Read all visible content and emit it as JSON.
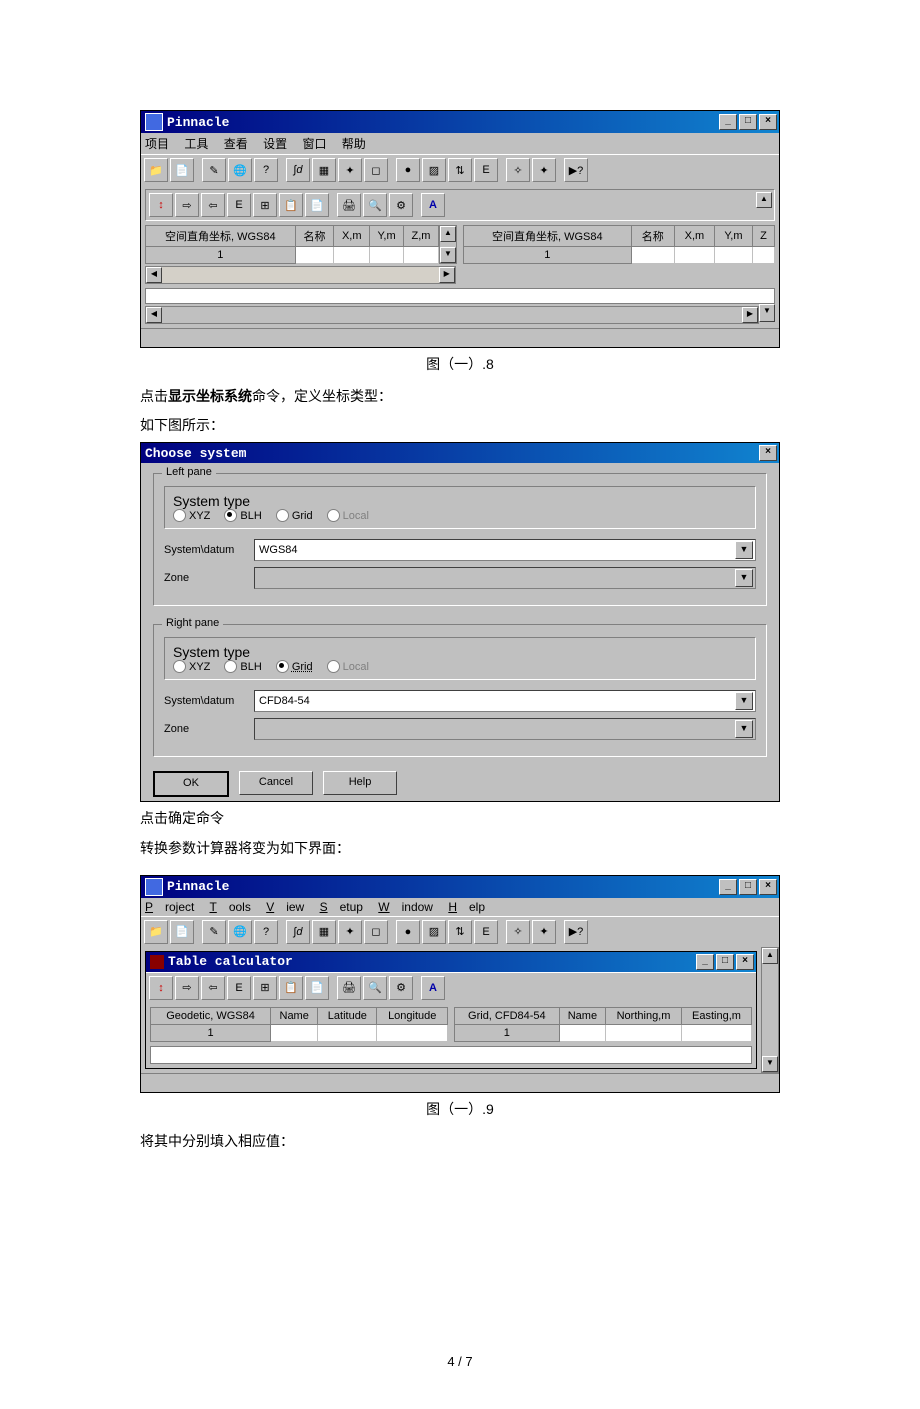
{
  "fig1": {
    "app_title": "Pinnacle",
    "menus": [
      "项目",
      "工具",
      "查看",
      "设置",
      "窗口",
      "帮助"
    ],
    "left_table": {
      "header": "空间直角坐标, WGS84",
      "cols": [
        "名称",
        "X,m",
        "Y,m",
        "Z,m"
      ],
      "row": "1"
    },
    "right_table": {
      "header": "空间直角坐标, WGS84",
      "cols": [
        "名称",
        "X,m",
        "Y,m",
        "Z"
      ],
      "row": "1"
    },
    "caption": "图（一）.8"
  },
  "para1": "点击",
  "para1b": "显示坐标系统",
  "para1c": "命令，定义坐标类型：",
  "para2": "如下图所示：",
  "dlg": {
    "title": "Choose system",
    "left": {
      "pane": "Left pane",
      "systype": "System type",
      "opts": [
        "XYZ",
        "BLH",
        "Grid",
        "Local"
      ],
      "sel": 1,
      "datum_label": "System\\datum",
      "datum": "WGS84",
      "zone_label": "Zone"
    },
    "right": {
      "pane": "Right pane",
      "systype": "System type",
      "opts": [
        "XYZ",
        "BLH",
        "Grid",
        "Local"
      ],
      "sel": 2,
      "datum_label": "System\\datum",
      "datum": "CFD84-54",
      "zone_label": "Zone"
    },
    "btns": {
      "ok": "OK",
      "cancel": "Cancel",
      "help": "Help"
    }
  },
  "para3": "点击确定命令",
  "para4": "转换参数计算器将变为如下界面：",
  "fig2": {
    "app_title": "Pinnacle",
    "menus": [
      "Project",
      "Tools",
      "View",
      "Setup",
      "Window",
      "Help"
    ],
    "child_title": "Table calculator",
    "left": {
      "header": "Geodetic, WGS84",
      "cols": [
        "Name",
        "Latitude",
        "Longitude"
      ],
      "row": "1"
    },
    "right": {
      "header": "Grid, CFD84-54",
      "cols": [
        "Name",
        "Northing,m",
        "Easting,m"
      ],
      "row": "1"
    },
    "caption": "图（一）.9"
  },
  "para5": "将其中分别填入相应值：",
  "pagenum": "4 / 7"
}
